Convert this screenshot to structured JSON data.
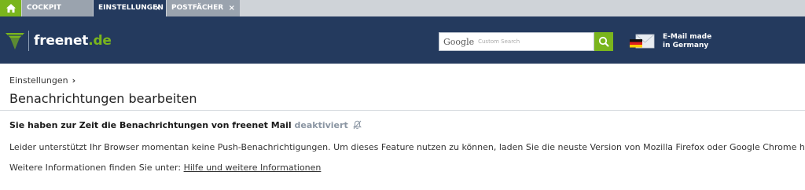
{
  "tabs": [
    {
      "label": "COCKPIT"
    },
    {
      "label": "EINSTELLUNGEN",
      "close": "×"
    },
    {
      "label": "POSTFÄCHER",
      "close": "×"
    }
  ],
  "header": {
    "logo_name": "freenet",
    "logo_tld": ".de",
    "search": {
      "brand": "Google",
      "placeholder": "Custom Search"
    },
    "badge": {
      "line1": "E-Mail made",
      "line2": "in Germany"
    }
  },
  "content": {
    "breadcrumb": "Einstellungen",
    "breadcrumb_sep": "›",
    "title": "Benachrichtungen bearbeiten",
    "status_text": "Sie haben zur Zeit die Benachrichtungen von freenet Mail",
    "status_state": "deaktiviert",
    "info": "Leider unterstützt Ihr Browser momentan keine Push-Benachrichtigungen. Um dieses Feature nutzen zu können, laden Sie die neuste Version von Mozilla Firefox oder Google Chrome herunter.",
    "more_prefix": "Weitere Informationen finden Sie unter:",
    "more_link": "Hilfe und weitere Informationen"
  },
  "colors": {
    "navy": "#243a5e",
    "green": "#7ab51d",
    "tab_inactive": "#9aa3ae"
  },
  "icons": [
    "home-icon",
    "close-icon",
    "freenet-logo-icon",
    "search-icon",
    "germany-mail-icon",
    "bell-off-icon"
  ]
}
